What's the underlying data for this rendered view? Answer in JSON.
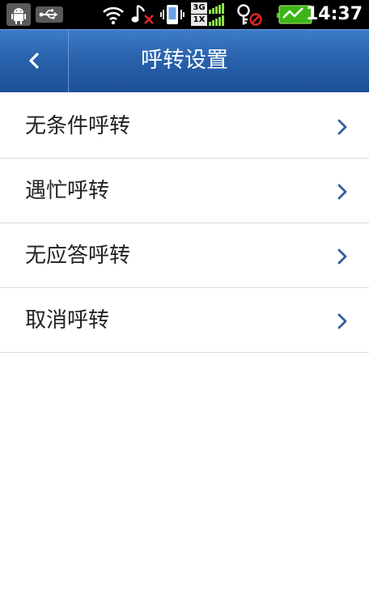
{
  "status_bar": {
    "time": "14:37",
    "network_label_top": "3G",
    "network_label_bottom": "1X",
    "icons": [
      "android-icon",
      "usb-icon",
      "wifi-icon",
      "music-muted-icon",
      "vibrate-icon",
      "signal-icon",
      "gps-off-icon",
      "battery-charging-icon"
    ]
  },
  "header": {
    "title": "呼转设置",
    "back_icon": "chevron-left-icon"
  },
  "menu": {
    "items": [
      {
        "label": "无条件呼转",
        "icon": "chevron-right-icon"
      },
      {
        "label": "遇忙呼转",
        "icon": "chevron-right-icon"
      },
      {
        "label": "无应答呼转",
        "icon": "chevron-right-icon"
      },
      {
        "label": "取消呼转",
        "icon": "chevron-right-icon"
      }
    ]
  },
  "colors": {
    "status_bar_bg": "#000000",
    "title_bar_top": "#3f7dc9",
    "title_bar_bottom": "#1c4f98",
    "chevron": "#2f5f9e",
    "divider": "#d9d9d9",
    "text": "#222222"
  }
}
